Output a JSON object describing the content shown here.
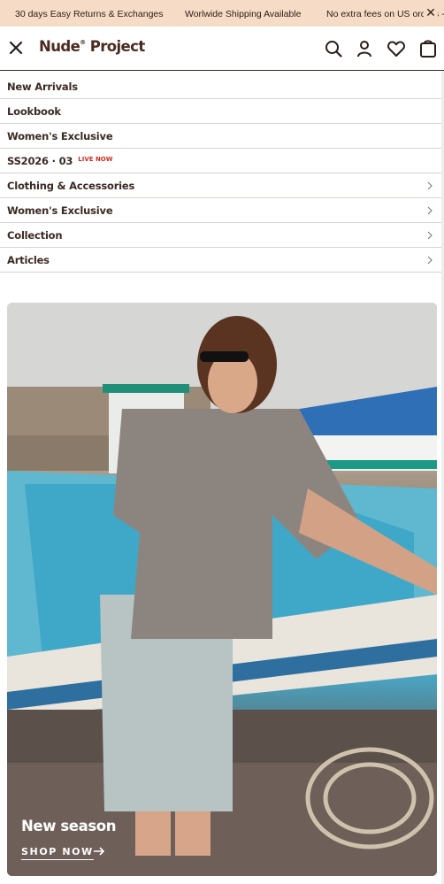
{
  "announcement": {
    "messages": [
      "30 days Easy Returns & Exchanges",
      "Worlwide Shipping Available",
      "No extra fees on US orders -"
    ],
    "close_icon": "close-icon"
  },
  "header": {
    "logo": "Nude",
    "logo_mark": "®",
    "logo_rest": "Project",
    "icons": [
      "close-icon",
      "search-icon",
      "user-icon",
      "heart-icon",
      "bag-icon"
    ]
  },
  "menu": {
    "items": [
      {
        "label": "New Arrivals",
        "has_children": false
      },
      {
        "label": "Lookbook",
        "has_children": false
      },
      {
        "label": "Women's Exclusive",
        "has_children": false
      },
      {
        "label": "SS2026 · 03",
        "badge": "LIVE NOW",
        "has_children": false
      },
      {
        "label": "Clothing & Accessories",
        "has_children": true
      },
      {
        "label": "Women's Exclusive",
        "has_children": true
      },
      {
        "label": "Collection",
        "has_children": true
      },
      {
        "label": "Articles",
        "has_children": true
      }
    ]
  },
  "hero": {
    "title": "New season",
    "cta": "SHOP NOW"
  },
  "colors": {
    "announcement_bg": "#f6dcc7",
    "text": "#3b2a22",
    "live_badge": "#d8281f"
  }
}
